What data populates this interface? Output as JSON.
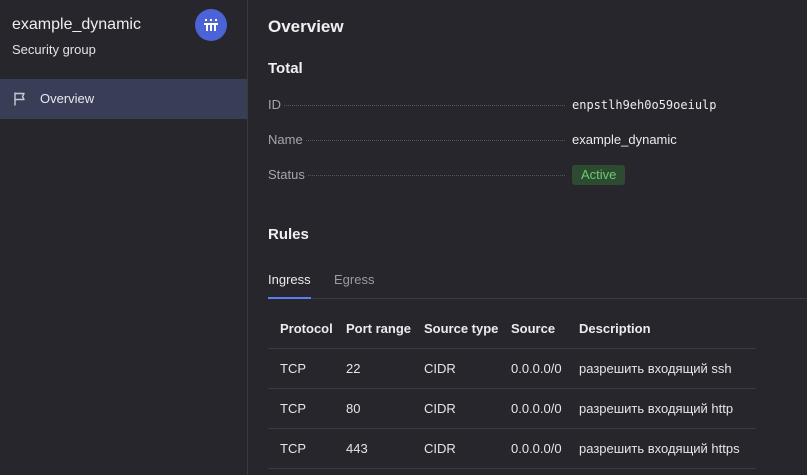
{
  "sidebar": {
    "title": "example_dynamic",
    "subtitle": "Security group",
    "badge_icon": "security-group-icon",
    "items": [
      {
        "label": "Overview",
        "icon": "flag-icon",
        "selected": true
      }
    ]
  },
  "main": {
    "title": "Overview",
    "total": {
      "heading": "Total",
      "fields": [
        {
          "label": "ID",
          "value": "enpstlh9eh0o59oeiulp"
        },
        {
          "label": "Name",
          "value": "example_dynamic"
        },
        {
          "label": "Status",
          "value": "Active"
        }
      ]
    },
    "rules": {
      "heading": "Rules",
      "tabs": [
        {
          "label": "Ingress",
          "active": true
        },
        {
          "label": "Egress",
          "active": false
        }
      ],
      "columns": [
        "Protocol",
        "Port range",
        "Source type",
        "Source",
        "Description"
      ],
      "rows": [
        [
          "TCP",
          "22",
          "CIDR",
          "0.0.0.0/0",
          "разрешить входящий ssh"
        ],
        [
          "TCP",
          "80",
          "CIDR",
          "0.0.0.0/0",
          "разрешить входящий http"
        ],
        [
          "TCP",
          "443",
          "CIDR",
          "0.0.0.0/0",
          "разрешить входящий https"
        ]
      ]
    }
  },
  "colors": {
    "background": "#27262c",
    "sidebar_selected": "#373e55",
    "accent": "#5b7ff0",
    "badge": "#4b63d6",
    "status_active_bg": "#2c4b30",
    "status_active_text": "#6fcb6f"
  }
}
